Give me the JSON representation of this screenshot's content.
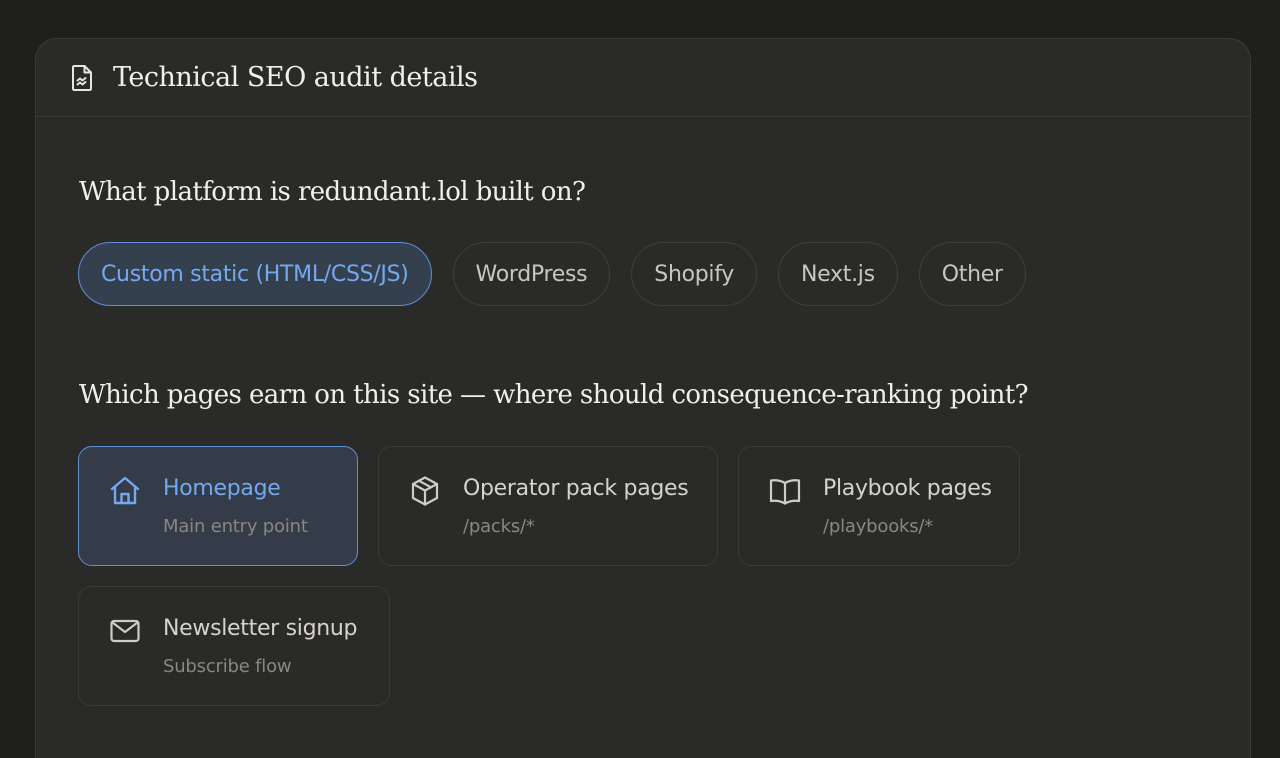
{
  "header": {
    "title": "Technical SEO audit details",
    "icon": "document-chart-icon"
  },
  "platform_question": {
    "text": "What platform is redundant.lol built on?",
    "options": [
      {
        "label": "Custom static (HTML/CSS/JS)",
        "selected": true
      },
      {
        "label": "WordPress",
        "selected": false
      },
      {
        "label": "Shopify",
        "selected": false
      },
      {
        "label": "Next.js",
        "selected": false
      },
      {
        "label": "Other",
        "selected": false
      }
    ]
  },
  "pages_question": {
    "text": "Which pages earn on this site — where should consequence-ranking point?",
    "options": [
      {
        "title": "Homepage",
        "subtitle": "Main entry point",
        "icon": "home-icon",
        "selected": true
      },
      {
        "title": "Operator pack pages",
        "subtitle": "/packs/*",
        "icon": "box-icon",
        "selected": false
      },
      {
        "title": "Playbook pages",
        "subtitle": "/playbooks/*",
        "icon": "book-open-icon",
        "selected": false
      },
      {
        "title": "Newsletter signup",
        "subtitle": "Subscribe flow",
        "icon": "mail-icon",
        "selected": false
      }
    ]
  },
  "colors": {
    "background": "#1f1f1e",
    "panel": "#2a2a29",
    "accent": "#74a8ef",
    "accent_border": "#5b8fd6",
    "selected_fill": "#35404f"
  }
}
